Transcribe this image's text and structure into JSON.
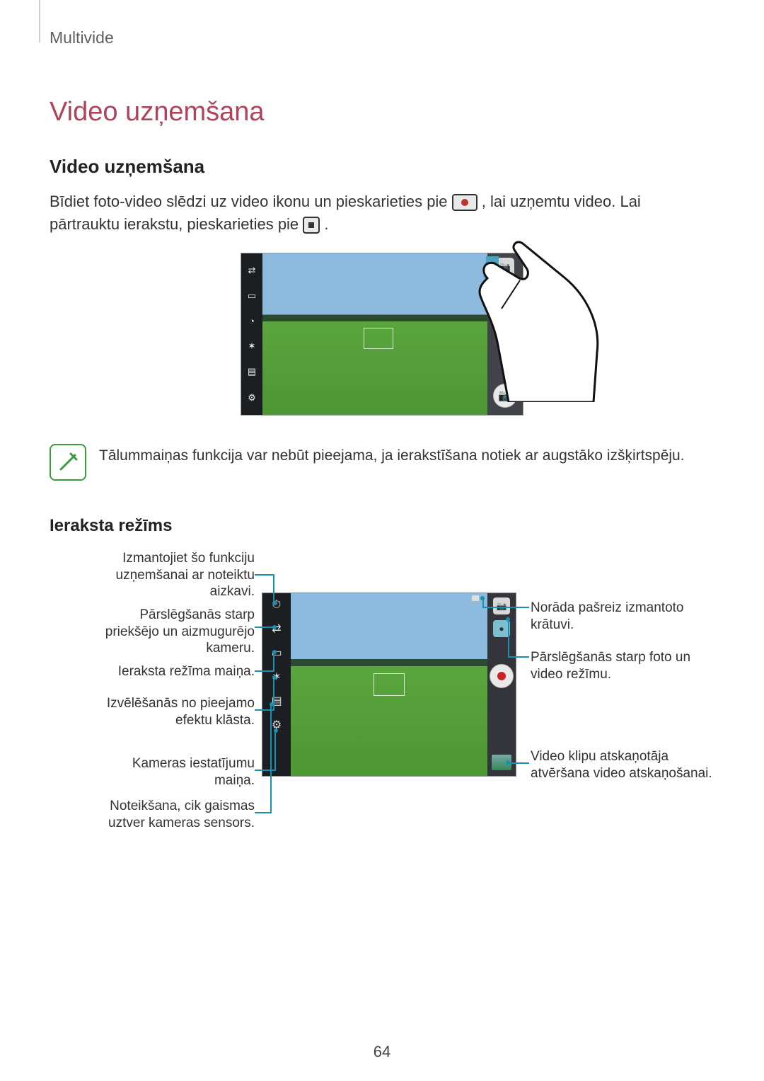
{
  "breadcrumb": "Multivide",
  "heading_main": "Video uzņemšana",
  "heading_sub": "Video uzņemšana",
  "paragraph": {
    "part1": "Bīdiet foto-video slēdzi uz video ikonu un pieskarieties pie ",
    "part2": ", lai uzņemtu video. Lai pārtrauktu ierakstu, pieskarieties pie ",
    "part3": "."
  },
  "note": "Tālummaiņas funkcija var nebūt pieejama, ja ierakstīšana notiek ar augstāko izšķirtspēju.",
  "heading_mode": "Ieraksta režīms",
  "callouts_left": [
    "Izmantojiet šo funkciju uzņemšanai ar noteiktu aizkavi.",
    "Pārslēgšanās starp priekšējo un aizmugurējo kameru.",
    "Ieraksta režīma maiņa.",
    "Izvēlēšanās no pieejamo efektu klāsta.",
    "Kameras iestatījumu maiņa.",
    "Noteikšana, cik gaismas uztver kameras sensors."
  ],
  "callouts_right": [
    "Norāda pašreiz izmantoto krātuvi.",
    "Pārslēgšanās starp foto un video režīmu.",
    "Video klipu atskaņotāja atvēršana video atskaņošanai."
  ],
  "page_number": "64"
}
